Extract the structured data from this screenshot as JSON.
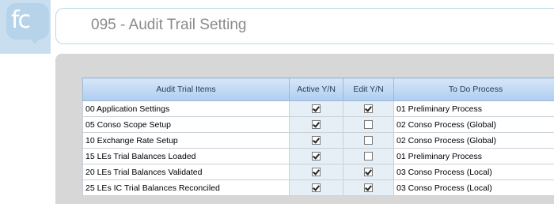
{
  "logo": {
    "text": "fc"
  },
  "header": {
    "title": "095 - Audit Trail Setting"
  },
  "table": {
    "columns": [
      "Audit Trial Items",
      "Active Y/N",
      "Edit Y/N",
      "To Do Process"
    ],
    "rows": [
      {
        "item": "00 Application Settings",
        "active": true,
        "edit": true,
        "todo": "01 Preliminary Process"
      },
      {
        "item": "05 Conso Scope Setup",
        "active": true,
        "edit": false,
        "todo": "02 Conso Process (Global)"
      },
      {
        "item": "10 Exchange Rate Setup",
        "active": true,
        "edit": false,
        "todo": "02 Conso Process (Global)"
      },
      {
        "item": "15 LEs Trial Balances Loaded",
        "active": true,
        "edit": false,
        "todo": "01 Preliminary Process"
      },
      {
        "item": "20 LEs Trial Balances Validated",
        "active": true,
        "edit": true,
        "todo": "03 Conso Process (Local)"
      },
      {
        "item": "25 LEs IC Trial Balances Reconciled",
        "active": true,
        "edit": true,
        "todo": "03 Conso Process (Local)"
      }
    ]
  }
}
